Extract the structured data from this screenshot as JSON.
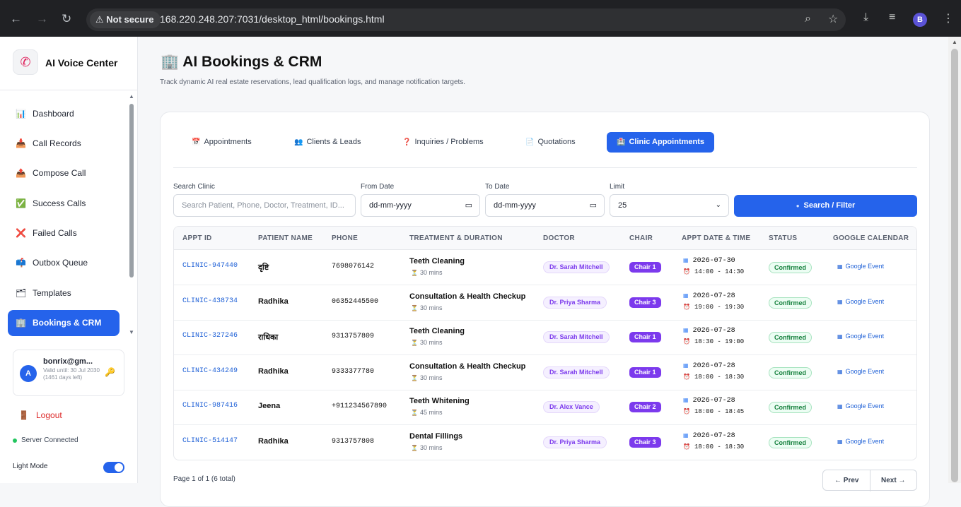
{
  "browser": {
    "security_label": "Not secure",
    "url": "168.220.248.207:7031/desktop_html/bookings.html",
    "profile_initial": "B"
  },
  "sidebar": {
    "brand": "AI Voice Center",
    "items": [
      {
        "label": "Dashboard",
        "icon": "📊"
      },
      {
        "label": "Call Records",
        "icon": "📥"
      },
      {
        "label": "Compose Call",
        "icon": "📤"
      },
      {
        "label": "Success Calls",
        "icon": "✅"
      },
      {
        "label": "Failed Calls",
        "icon": "❌"
      },
      {
        "label": "Outbox Queue",
        "icon": "📫"
      },
      {
        "label": "Templates",
        "icon": "🗂"
      },
      {
        "label": "Bookings & CRM",
        "icon": "🏢",
        "active": true
      }
    ],
    "user": {
      "initial": "A",
      "email": "bonrix@gm...",
      "valid": "Valid until: 30 Jul 2030",
      "days": "(1461 days left)"
    },
    "logout": "Logout",
    "server_status": "Server Connected",
    "mode_label": "Light Mode"
  },
  "page": {
    "title": "AI Bookings & CRM",
    "title_icon": "🏢",
    "subtitle": "Track dynamic AI real estate reservations, lead qualification logs, and manage notification targets."
  },
  "tabs": [
    {
      "label": "Appointments",
      "icon": "📅"
    },
    {
      "label": "Clients & Leads",
      "icon": "👥"
    },
    {
      "label": "Inquiries / Problems",
      "icon": "❓"
    },
    {
      "label": "Quotations",
      "icon": "📄"
    },
    {
      "label": "Clinic Appointments",
      "icon": "🏥",
      "active": true
    }
  ],
  "filters": {
    "search_label": "Search Clinic",
    "search_placeholder": "Search Patient, Phone, Doctor, Treatment, ID...",
    "from_label": "From Date",
    "from_value": "dd-mm-yyyy",
    "to_label": "To Date",
    "to_value": "dd-mm-yyyy",
    "limit_label": "Limit",
    "limit_value": "25",
    "search_button": "Search / Filter"
  },
  "table": {
    "headers": [
      "APPT ID",
      "PATIENT NAME",
      "PHONE",
      "TREATMENT & DURATION",
      "DOCTOR",
      "CHAIR",
      "APPT DATE & TIME",
      "STATUS",
      "GOOGLE CALENDAR"
    ],
    "rows": [
      {
        "id": "CLINIC-947440",
        "name": "दृष्टि",
        "phone": "7698076142",
        "treatment": "Teeth Cleaning",
        "duration": "30 mins",
        "doctor": "Dr. Sarah Mitchell",
        "chair": "Chair 1",
        "date": "2026-07-30",
        "time": "14:00 - 14:30",
        "status": "Confirmed",
        "gcal": "Google Event"
      },
      {
        "id": "CLINIC-438734",
        "name": "Radhika",
        "phone": "06352445500",
        "treatment": "Consultation & Health Checkup",
        "duration": "30 mins",
        "doctor": "Dr. Priya Sharma",
        "chair": "Chair 3",
        "date": "2026-07-28",
        "time": "19:00 - 19:30",
        "status": "Confirmed",
        "gcal": "Google Event"
      },
      {
        "id": "CLINIC-327246",
        "name": "राधिका",
        "phone": "9313757809",
        "treatment": "Teeth Cleaning",
        "duration": "30 mins",
        "doctor": "Dr. Sarah Mitchell",
        "chair": "Chair 1",
        "date": "2026-07-28",
        "time": "18:30 - 19:00",
        "status": "Confirmed",
        "gcal": "Google Event"
      },
      {
        "id": "CLINIC-434249",
        "name": "Radhika",
        "phone": "9333377780",
        "treatment": "Consultation & Health Checkup",
        "duration": "30 mins",
        "doctor": "Dr. Sarah Mitchell",
        "chair": "Chair 1",
        "date": "2026-07-28",
        "time": "18:00 - 18:30",
        "status": "Confirmed",
        "gcal": "Google Event"
      },
      {
        "id": "CLINIC-987416",
        "name": "Jeena",
        "phone": "+911234567890",
        "treatment": "Teeth Whitening",
        "duration": "45 mins",
        "doctor": "Dr. Alex Vance",
        "chair": "Chair 2",
        "date": "2026-07-28",
        "time": "18:00 - 18:45",
        "status": "Confirmed",
        "gcal": "Google Event"
      },
      {
        "id": "CLINIC-514147",
        "name": "Radhika",
        "phone": "9313757808",
        "treatment": "Dental Fillings",
        "duration": "30 mins",
        "doctor": "Dr. Priya Sharma",
        "chair": "Chair 3",
        "date": "2026-07-28",
        "time": "18:00 - 18:30",
        "status": "Confirmed",
        "gcal": "Google Event"
      }
    ]
  },
  "pagination": {
    "info": "Page 1 of 1 (6 total)",
    "prev": "← Prev",
    "next": "Next →"
  },
  "colors": {
    "accent": "#2563eb",
    "chair": "#7c3aed",
    "status_confirmed": "#15803d"
  }
}
